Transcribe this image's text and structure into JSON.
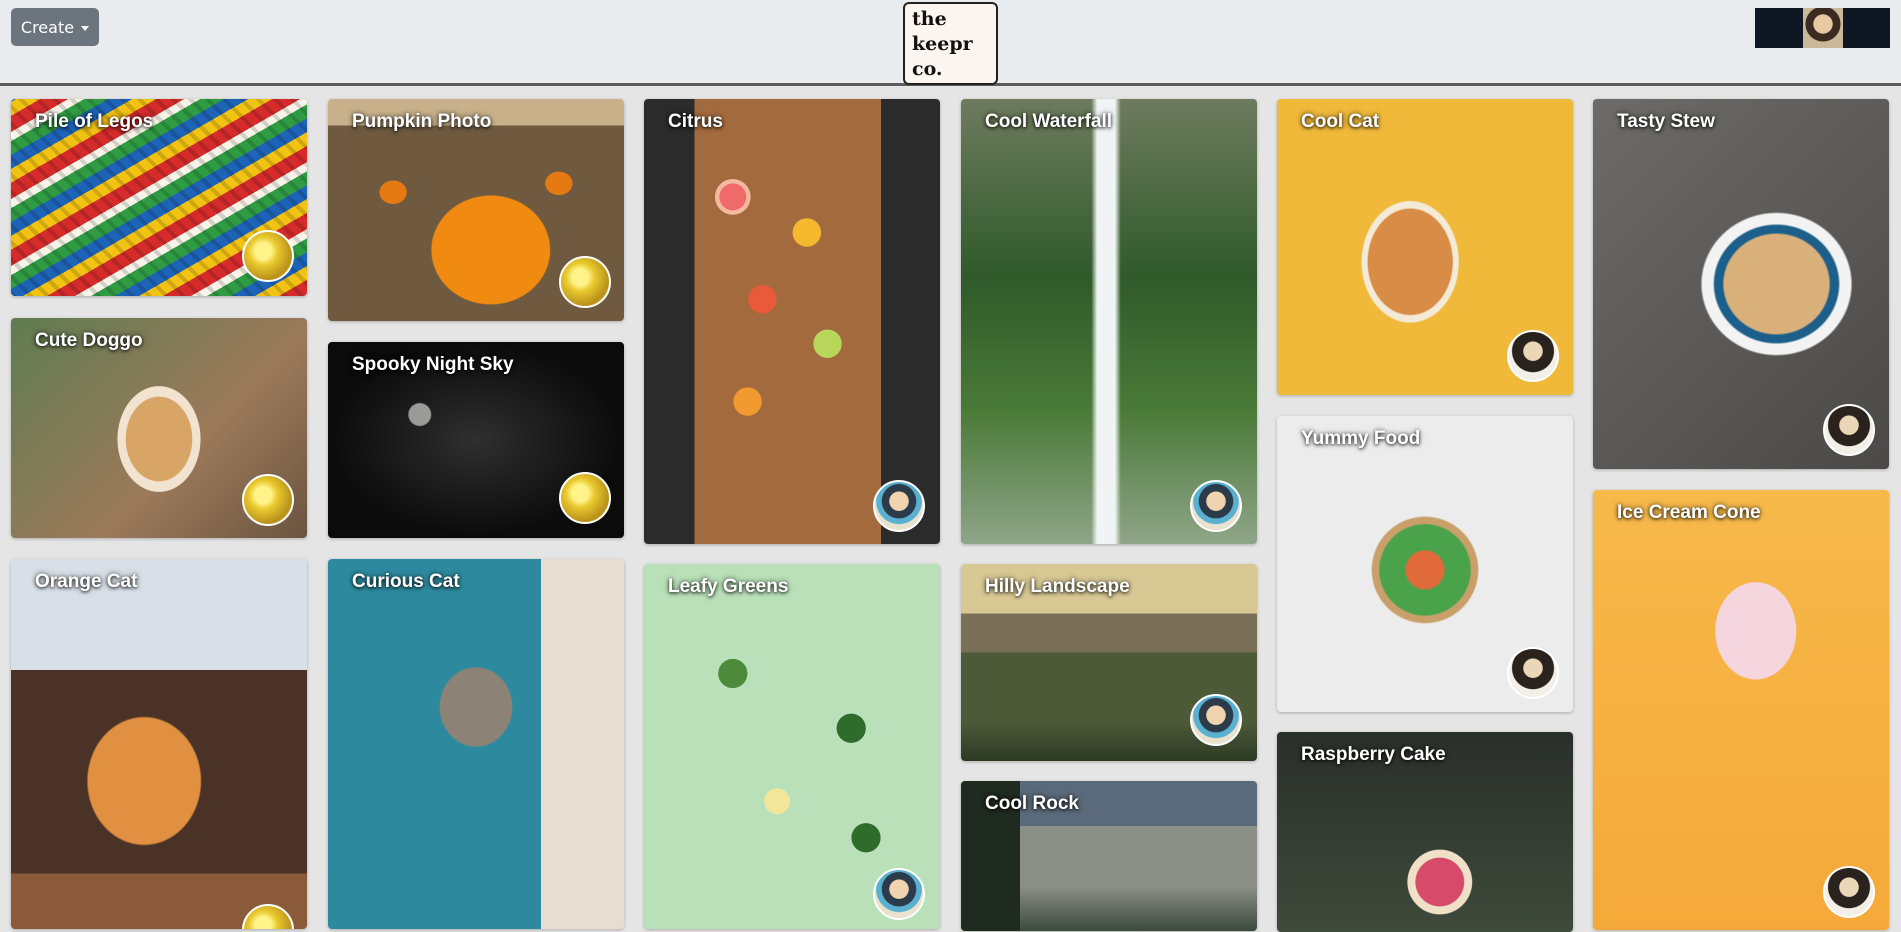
{
  "navbar": {
    "create_label": "Create",
    "logo_lines": [
      "the",
      "keepr",
      "co."
    ]
  },
  "cards": [
    {
      "title": "Pile of Legos"
    },
    {
      "title": "Pumpkin Photo"
    },
    {
      "title": "Citrus"
    },
    {
      "title": "Cool Waterfall"
    },
    {
      "title": "Cool Cat"
    },
    {
      "title": "Tasty Stew"
    },
    {
      "title": "Cute Doggo"
    },
    {
      "title": "Spooky Night Sky"
    },
    {
      "title": "Yummy Food"
    },
    {
      "title": "Ice Cream Cone"
    },
    {
      "title": "Orange Cat"
    },
    {
      "title": "Curious Cat"
    },
    {
      "title": "Leafy Greens"
    },
    {
      "title": "Hilly Landscape"
    },
    {
      "title": "Cool Rock"
    },
    {
      "title": "Raspberry Cake"
    }
  ]
}
